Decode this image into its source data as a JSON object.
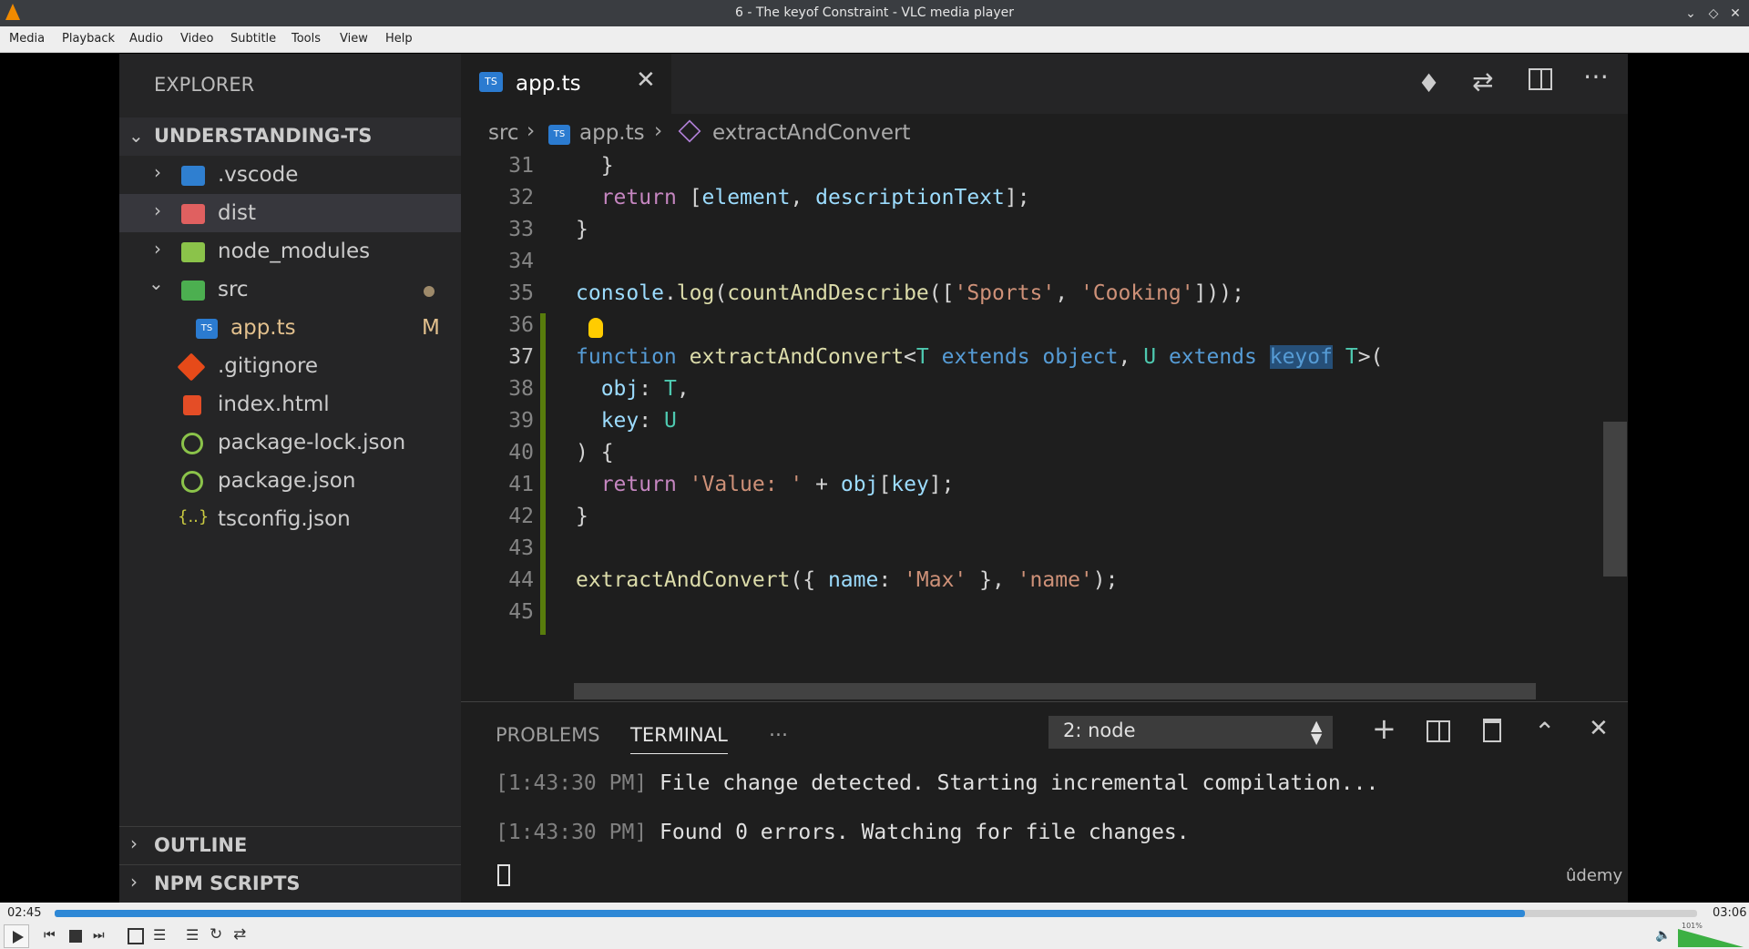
{
  "window": {
    "title": "6 - The keyof Constraint - VLC media player"
  },
  "menu": [
    "Media",
    "Playback",
    "Audio",
    "Video",
    "Subtitle",
    "Tools",
    "View",
    "Help"
  ],
  "sidebar": {
    "header": "EXPLORER",
    "project": "UNDERSTANDING-TS",
    "items": [
      {
        "label": ".vscode"
      },
      {
        "label": "dist"
      },
      {
        "label": "node_modules"
      },
      {
        "label": "src"
      },
      {
        "label": "app.ts",
        "badge": "M"
      },
      {
        "label": ".gitignore"
      },
      {
        "label": "index.html"
      },
      {
        "label": "package-lock.json"
      },
      {
        "label": "package.json"
      },
      {
        "label": "tsconfig.json"
      }
    ],
    "outline": "OUTLINE",
    "npm": "NPM SCRIPTS"
  },
  "editor": {
    "tab": "app.ts",
    "breadcrumb": [
      "src",
      "app.ts",
      "extractAndConvert"
    ],
    "line_numbers": [
      "31",
      "32",
      "33",
      "34",
      "35",
      "36",
      "37",
      "38",
      "39",
      "40",
      "41",
      "42",
      "43",
      "44",
      "45"
    ]
  },
  "panel": {
    "tabs": [
      "PROBLEMS",
      "TERMINAL",
      "..."
    ],
    "terminal_select": "2: node",
    "lines": [
      {
        "time": "[1:43:30 PM]",
        "msg": "File change detected. Starting incremental compilation..."
      },
      {
        "time": "[1:43:30 PM]",
        "msg": "Found 0 errors. Watching for file changes."
      }
    ]
  },
  "watermark": "ûdemy",
  "player": {
    "elapsed": "02:45",
    "total": "03:06",
    "progress": 0.895,
    "volume_label": "101%",
    "volume": 1.0
  },
  "colors": {
    "accent": "#2e88d6",
    "titlebar": "#3a3d41"
  }
}
